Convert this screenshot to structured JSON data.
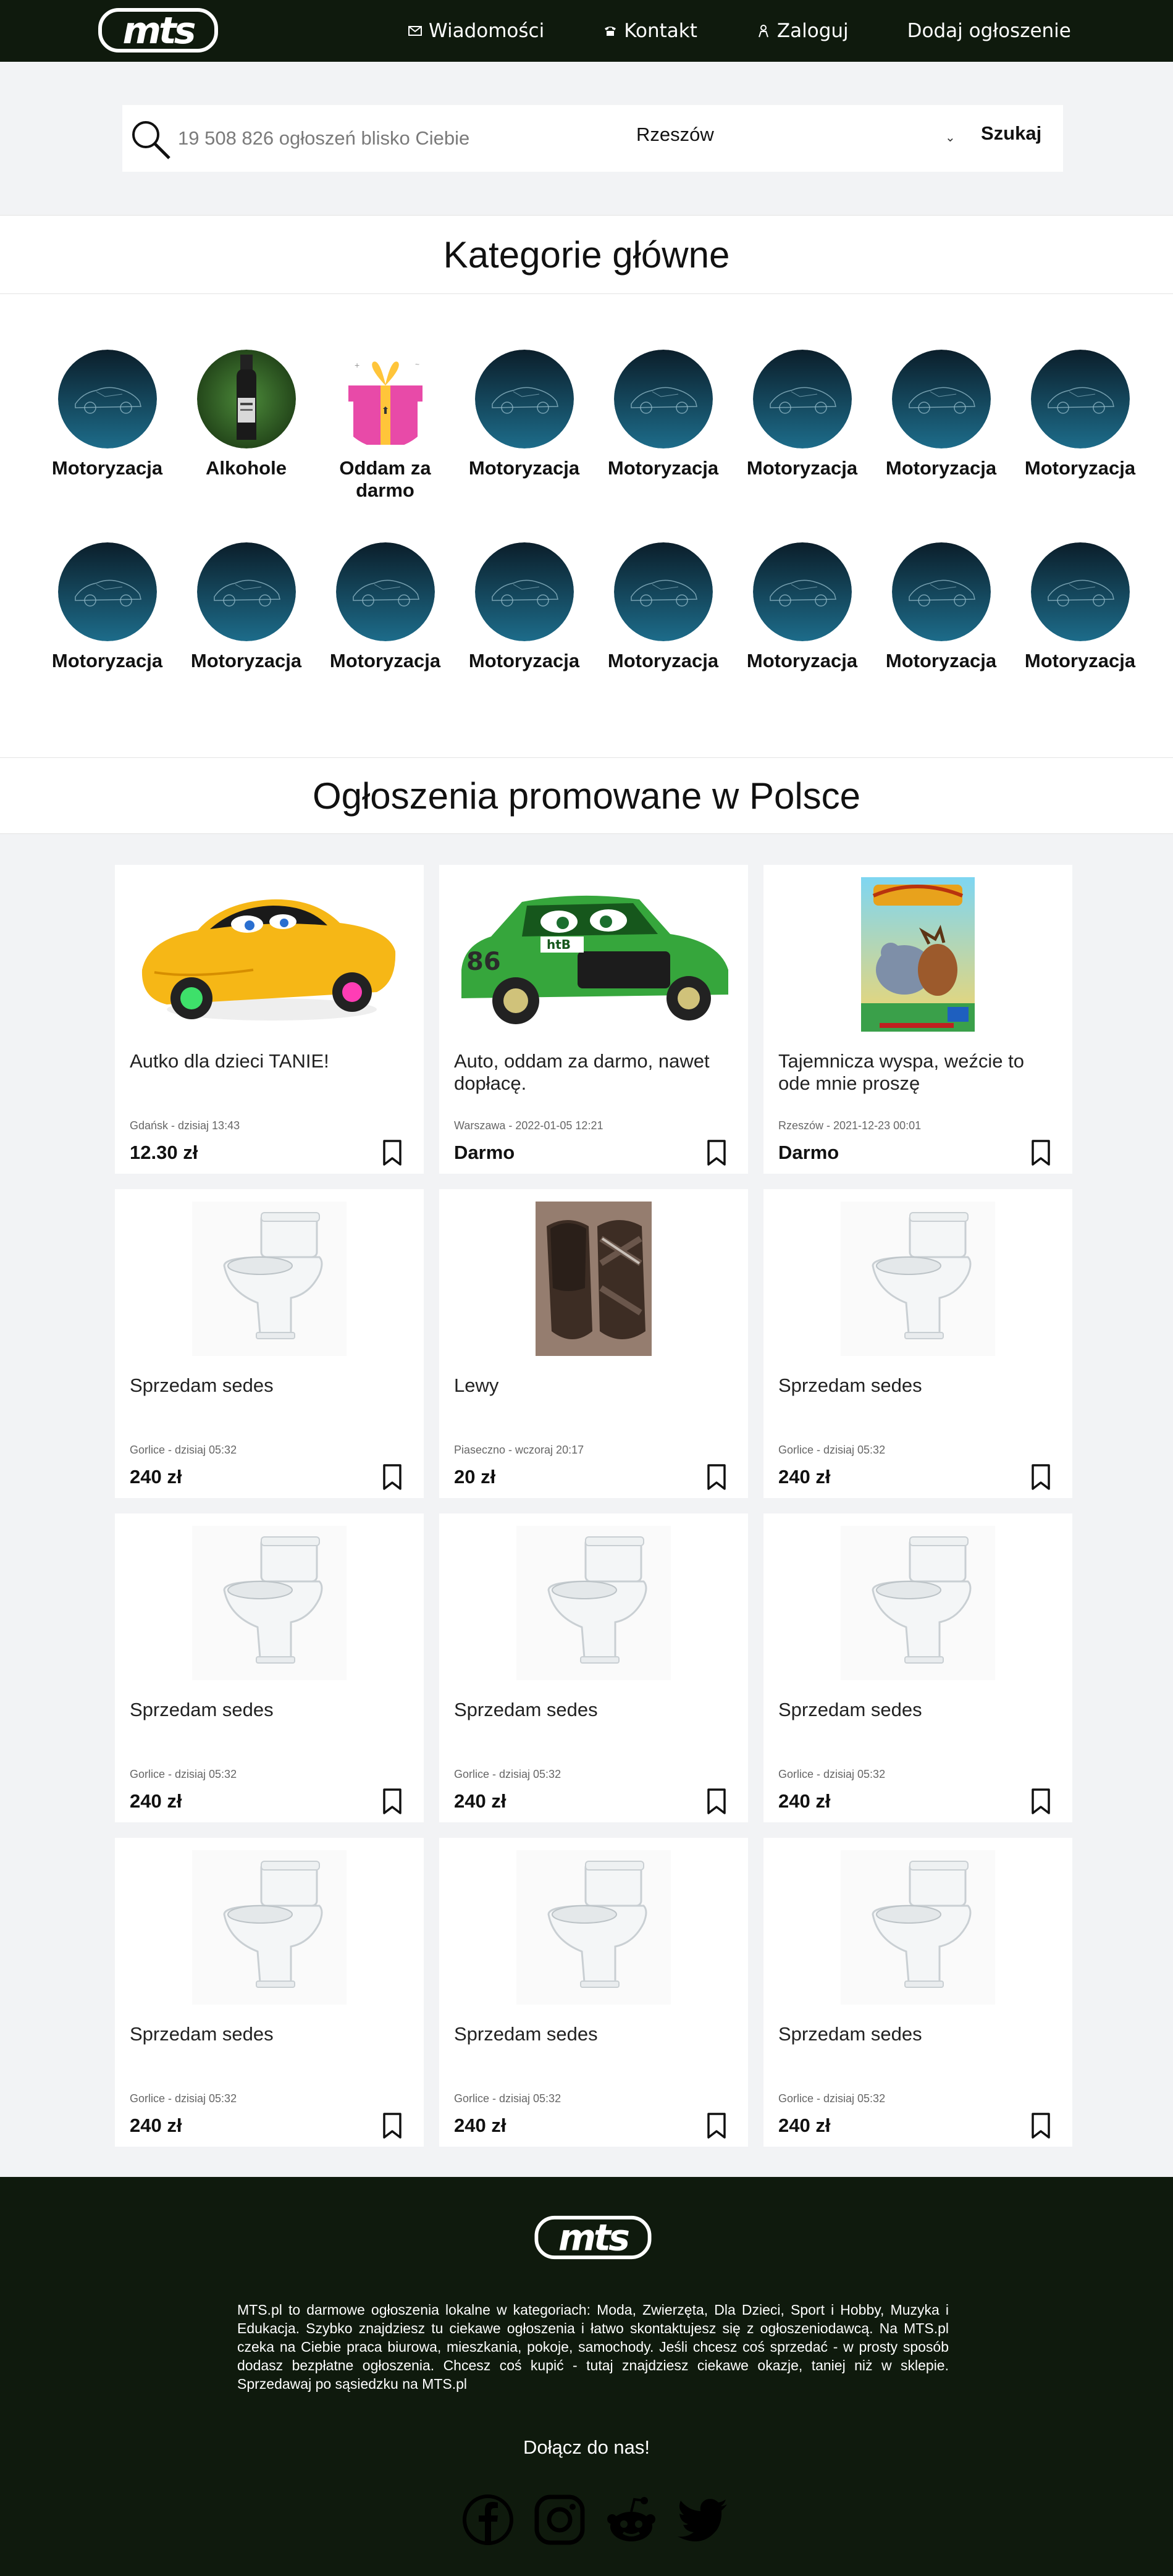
{
  "header": {
    "logo_text": "mts",
    "nav": [
      {
        "label": "Wiadomości",
        "icon": "envelope-icon"
      },
      {
        "label": "Kontakt",
        "icon": "phone-icon"
      },
      {
        "label": "Zaloguj",
        "icon": "user-icon"
      },
      {
        "label": "Dodaj ogłoszenie",
        "icon": ""
      }
    ]
  },
  "search": {
    "placeholder": "19 508 826 ogłoszeń blisko Ciebie",
    "location": "Rzeszów",
    "button_label": "Szukaj"
  },
  "categories_section": {
    "title": "Kategorie główne",
    "items": [
      {
        "label": "Motoryzacja",
        "icon": "car-icon"
      },
      {
        "label": "Alkohole",
        "icon": "bottle-icon"
      },
      {
        "label": "Oddam za darmo",
        "icon": "gift-icon"
      },
      {
        "label": "Motoryzacja",
        "icon": "car-icon"
      },
      {
        "label": "Motoryzacja",
        "icon": "car-icon"
      },
      {
        "label": "Motoryzacja",
        "icon": "car-icon"
      },
      {
        "label": "Motoryzacja",
        "icon": "car-icon"
      },
      {
        "label": "Motoryzacja",
        "icon": "car-icon"
      },
      {
        "label": "Motoryzacja",
        "icon": "car-icon"
      },
      {
        "label": "Motoryzacja",
        "icon": "car-icon"
      },
      {
        "label": "Motoryzacja",
        "icon": "car-icon"
      },
      {
        "label": "Motoryzacja",
        "icon": "car-icon"
      },
      {
        "label": "Motoryzacja",
        "icon": "car-icon"
      },
      {
        "label": "Motoryzacja",
        "icon": "car-icon"
      },
      {
        "label": "Motoryzacja",
        "icon": "car-icon"
      },
      {
        "label": "Motoryzacja",
        "icon": "car-icon"
      }
    ]
  },
  "promoted_section": {
    "title": "Ogłoszenia promowane w Polsce",
    "listings": [
      {
        "title": "Autko dla dzieci TANIE!",
        "meta": "Gdańsk - dzisiaj 13:43",
        "price": "12.30 zł",
        "image": "toy-car-image"
      },
      {
        "title": "Auto, oddam za darmo, nawet dopłacę.",
        "meta": "Warszawa - 2022-01-05 12:21",
        "price": "Darmo",
        "image": "green-car-image"
      },
      {
        "title": "Tajemnicza wyspa, weźcie to ode mnie proszę",
        "meta": "Rzeszów - 2021-12-23 00:01",
        "price": "Darmo",
        "image": "game-box-image"
      },
      {
        "title": "Sprzedam sedes",
        "meta": "Gorlice - dzisiaj 05:32",
        "price": "240 zł",
        "image": "toilet-image"
      },
      {
        "title": "Lewy",
        "meta": "Piaseczno - wczoraj 20:17",
        "price": "20 zł",
        "image": "slippers-image"
      },
      {
        "title": "Sprzedam sedes",
        "meta": "Gorlice - dzisiaj 05:32",
        "price": "240 zł",
        "image": "toilet-image"
      },
      {
        "title": "Sprzedam sedes",
        "meta": "Gorlice - dzisiaj 05:32",
        "price": "240 zł",
        "image": "toilet-image"
      },
      {
        "title": "Sprzedam sedes",
        "meta": "Gorlice - dzisiaj 05:32",
        "price": "240 zł",
        "image": "toilet-image"
      },
      {
        "title": "Sprzedam sedes",
        "meta": "Gorlice - dzisiaj 05:32",
        "price": "240 zł",
        "image": "toilet-image"
      },
      {
        "title": "Sprzedam sedes",
        "meta": "Gorlice - dzisiaj 05:32",
        "price": "240 zł",
        "image": "toilet-image"
      },
      {
        "title": "Sprzedam sedes",
        "meta": "Gorlice - dzisiaj 05:32",
        "price": "240 zł",
        "image": "toilet-image"
      },
      {
        "title": "Sprzedam sedes",
        "meta": "Gorlice - dzisiaj 05:32",
        "price": "240 zł",
        "image": "toilet-image"
      }
    ]
  },
  "footer": {
    "logo_text": "mts",
    "description": "MTS.pl to darmowe ogłoszenia lokalne w kategoriach: Moda, Zwierzęta, Dla Dzieci, Sport i Hobby, Muzyka i Edukacja. Szybko znajdziesz tu ciekawe ogłoszenia i łatwo skontaktujesz się z ogłoszeniodawcą. Na MTS.pl czeka na Ciebie praca biurowa, mieszkania, pokoje, samochody. Jeśli chcesz coś sprzedać - w prosty sposób dodasz bezpłatne ogłoszenia. Chcesz coś kupić - tutaj znajdziesz ciekawe okazje, taniej niż w sklepie. Sprzedawaj po sąsiedzku na MTS.pl",
    "join_label": "Dołącz do nas!",
    "socials": [
      "facebook-icon",
      "instagram-icon",
      "reddit-icon",
      "twitter-icon"
    ]
  },
  "colors": {
    "header_bg": "#0f1a0d",
    "page_bg": "#f2f3f5",
    "card_bg": "#ffffff"
  }
}
